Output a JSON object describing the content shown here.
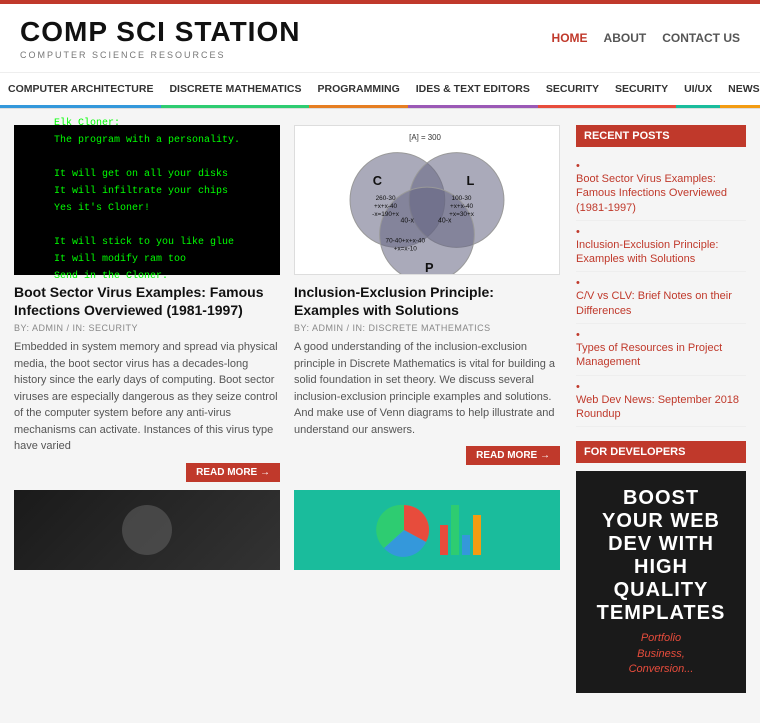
{
  "site": {
    "title": "COMP SCI STATION",
    "subtitle": "COMPUTER SCIENCE RESOURCES"
  },
  "header_nav": [
    {
      "label": "HOME",
      "active": true
    },
    {
      "label": "ABOUT",
      "active": false
    },
    {
      "label": "CONTACT US",
      "active": false
    }
  ],
  "nav_items": [
    {
      "label": "COMPUTER ARCHITECTURE",
      "color": "#3498db"
    },
    {
      "label": "DISCRETE MATHEMATICS",
      "color": "#2ecc71"
    },
    {
      "label": "PROGRAMMING",
      "color": "#e67e22"
    },
    {
      "label": "IDES & TEXT EDITORS",
      "color": "#9b59b6"
    },
    {
      "label": "SECURITY",
      "color": "#e74c3c"
    },
    {
      "label": "SECURITY",
      "color": "#e74c3c"
    },
    {
      "label": "UI/UX",
      "color": "#1abc9c"
    },
    {
      "label": "NEWS",
      "color": "#f39c12"
    }
  ],
  "article1": {
    "title": "Boot Sector Virus Examples: Famous Infections Overviewed (1981-1997)",
    "meta": "BY: ADMIN  /  IN: SECURITY",
    "excerpt": "Embedded in system memory and spread via physical media, the boot sector virus has a decades-long history since the early days of computing. Boot sector viruses are especially dangerous as they seize control of the computer system before any anti-virus mechanisms can activate. Instances of this virus type have varied",
    "read_more": "READ MORE →",
    "green_text_lines": [
      "Elk Cloner:",
      "The program with a personality.",
      "",
      "It will get on all your disks",
      "It will infiltrate your chips",
      "Yes it's Cloner!",
      "",
      "It will stick to you like glue",
      "It will modify ram too",
      "Send in the Cloner."
    ]
  },
  "article2": {
    "title": "Inclusion-Exclusion Principle: Examples with Solutions",
    "meta": "BY: ADMIN  /  IN: DISCRETE MATHEMATICS",
    "excerpt": "A good understanding of the inclusion-exclusion principle in Discrete Mathematics is vital for building a solid foundation in set theory. We discuss several inclusion-exclusion principle examples and solutions. And make use of Venn diagrams to help illustrate and understand our answers.",
    "read_more": "READ MORE →"
  },
  "recent_posts_title": "RECENT POSTS",
  "recent_posts": [
    {
      "label": "Boot Sector Virus Examples: Famous Infections Overviewed (1981-1997)"
    },
    {
      "label": "Inclusion-Exclusion Principle: Examples with Solutions"
    },
    {
      "label": "C/V vs CLV: Brief Notes on their Differences"
    },
    {
      "label": "Types of Resources in Project Management"
    },
    {
      "label": "Web Dev News: September 2018 Roundup"
    }
  ],
  "for_developers_title": "FOR DEVELOPERS",
  "dev_banner": {
    "line1": "BOOST",
    "line2": "YOUR WEB",
    "line3": "DEV WITH",
    "line4": "HIGH",
    "line5": "QUALITY",
    "line6": "TEMPLATES",
    "sub_lines": "Portfolio\nBusiness,\nConversion..."
  }
}
